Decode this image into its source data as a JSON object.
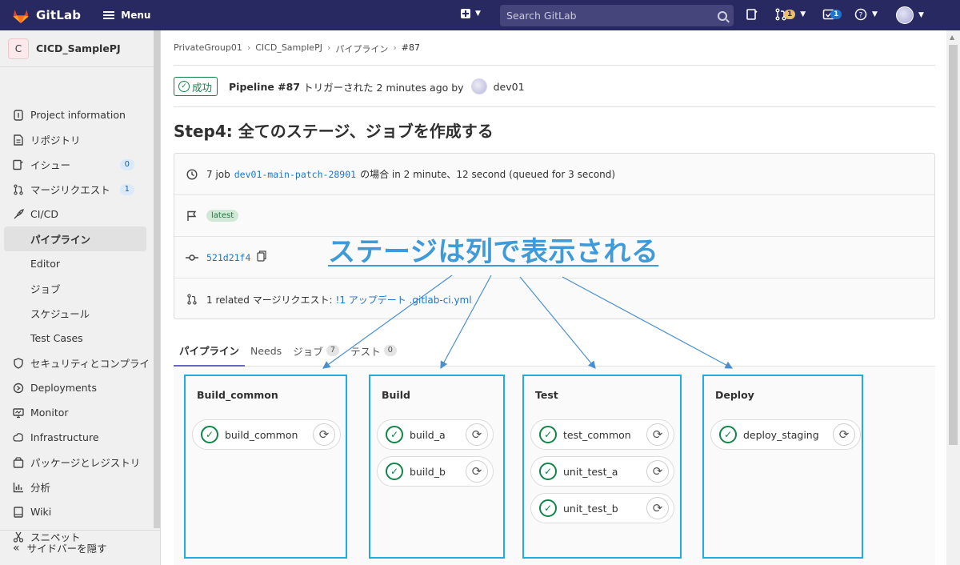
{
  "topbar": {
    "brand": "GitLab",
    "menu_label": "Menu",
    "search_placeholder": "Search GitLab",
    "mr_count": "1",
    "todo_count": "1"
  },
  "sidebar": {
    "project_initial": "C",
    "project_name": "CICD_SamplePJ",
    "items": [
      {
        "label": "Project information",
        "icon": "info-icon"
      },
      {
        "label": "リポジトリ",
        "icon": "doc-icon"
      },
      {
        "label": "イシュー",
        "icon": "issues-icon",
        "count": "0"
      },
      {
        "label": "マージリクエスト",
        "icon": "merge-request-icon",
        "count": "1"
      },
      {
        "label": "CI/CD",
        "icon": "rocket-icon"
      },
      {
        "label": "パイプライン"
      },
      {
        "label": "Editor"
      },
      {
        "label": "ジョブ"
      },
      {
        "label": "スケジュール"
      },
      {
        "label": "Test Cases"
      },
      {
        "label": "セキュリティとコンプライ",
        "icon": "shield-icon"
      },
      {
        "label": "Deployments",
        "icon": "deployments-icon"
      },
      {
        "label": "Monitor",
        "icon": "monitor-icon"
      },
      {
        "label": "Infrastructure",
        "icon": "infrastructure-icon"
      },
      {
        "label": "パッケージとレジストリ",
        "icon": "package-icon"
      },
      {
        "label": "分析",
        "icon": "chart-icon"
      },
      {
        "label": "Wiki",
        "icon": "book-icon"
      },
      {
        "label": "スニペット",
        "icon": "scissors-icon"
      }
    ],
    "collapse_label": "サイドバーを隠す"
  },
  "breadcrumb": [
    "PrivateGroup01",
    "CICD_SamplePJ",
    "パイプライン",
    "#87"
  ],
  "pipeline": {
    "status": "成功",
    "id_label": "Pipeline #87",
    "triggered_text": "トリガーされた 2 minutes ago by",
    "user": "dev01",
    "title": "Step4: 全てのステージ、ジョブを作成する",
    "jobs_prefix": "7 job",
    "branch": "dev01-main-patch-28901",
    "duration_text": "の場合 in 2 minute、12 second (queued for 3 second)",
    "tag": "latest",
    "commit": "521d21f4",
    "mr_prefix": "1 related マージリクエスト:",
    "mr_link": "!1 アップデート .gitlab-ci.yml"
  },
  "tabs": [
    {
      "label": "パイプライン",
      "active": true
    },
    {
      "label": "Needs"
    },
    {
      "label": "ジョブ",
      "count": "7"
    },
    {
      "label": "テスト",
      "count": "0"
    }
  ],
  "stages": [
    {
      "name": "Build_common",
      "jobs": [
        "build_common"
      ]
    },
    {
      "name": "Build",
      "jobs": [
        "build_a",
        "build_b"
      ]
    },
    {
      "name": "Test",
      "jobs": [
        "test_common",
        "unit_test_a",
        "unit_test_b"
      ]
    },
    {
      "name": "Deploy",
      "jobs": [
        "deploy_staging"
      ]
    }
  ],
  "annotation": {
    "text": "ステージは列で表示される",
    "color": "#3f9ad8"
  },
  "colors": {
    "topbar": "#292961",
    "success": "#108548",
    "stage_highlight": "#1aaee2",
    "link": "#1f75cb"
  }
}
